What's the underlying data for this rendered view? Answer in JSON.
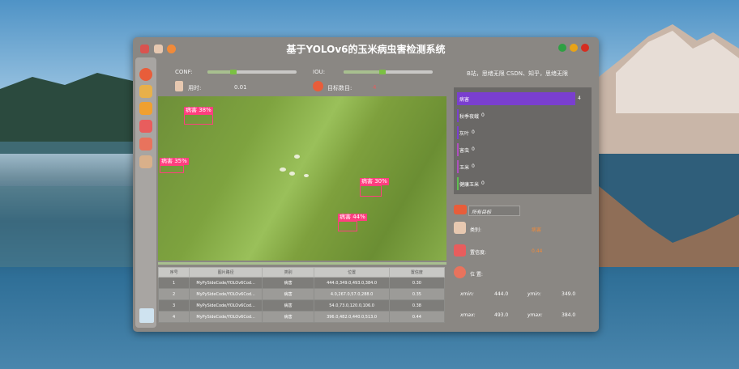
{
  "window": {
    "title": "基于YOLOv6的玉米病虫害检测系统"
  },
  "controls": {
    "conf_label": "CONF:",
    "iou_label": "IOU:",
    "time_label": "用时:",
    "time_value": "0.01",
    "count_label": "目标数目:",
    "count_value": "4",
    "credit": "B站，思绪无限 CSDN、知乎，思绪无限"
  },
  "detections": [
    {
      "label": "病害 38%"
    },
    {
      "label": "病害 35%"
    },
    {
      "label": "病害 30%"
    },
    {
      "label": "病害 44%"
    }
  ],
  "table": {
    "headers": [
      "序号",
      "图片路径",
      "类别",
      "位置",
      "置信度"
    ],
    "rows": [
      [
        "1",
        "MyPySideCode/YOLOv6Cod...",
        "病害",
        "444.0,349.0,493.0,384.0",
        "0.30"
      ],
      [
        "2",
        "MyPySideCode/YOLOv6Cod...",
        "病害",
        "4.0,267.0,57.0,288.0",
        "0.35"
      ],
      [
        "3",
        "MyPySideCode/YOLOv6Cod...",
        "病害",
        "54.0,73.0,120.0,106.0",
        "0.38"
      ],
      [
        "4",
        "MyPySideCode/YOLOv6Cod...",
        "病害",
        "396.0,482.0,440.0,513.0",
        "0.44"
      ]
    ]
  },
  "chart_data": {
    "type": "bar",
    "categories": [
      "病害",
      "秋季夜蛾",
      "灰叶",
      "害虫",
      "玉米",
      "健康玉米"
    ],
    "values": [
      4,
      0,
      0,
      0,
      0,
      0
    ],
    "colors": [
      "#7a3fcf",
      "#7a3fcf",
      "#7a3fcf",
      "#b04fc0",
      "#b04fc0",
      "#5fc04f"
    ]
  },
  "result": {
    "select_value": "所有目标",
    "type_label": "类别:",
    "type_value": "病害",
    "conf_label": "置信度:",
    "conf_value": "0.44",
    "pos_label": "位 置:",
    "xmin_label": "xmin:",
    "xmin_value": "444.0",
    "ymin_label": "ymin:",
    "ymin_value": "349.0",
    "xmax_label": "xmax:",
    "xmax_value": "493.0",
    "ymax_label": "ymax:",
    "ymax_value": "384.0"
  },
  "colors": {
    "accent": "#7bc043",
    "box": "#ff3f7f",
    "selected_row": "#1a7fd6"
  }
}
